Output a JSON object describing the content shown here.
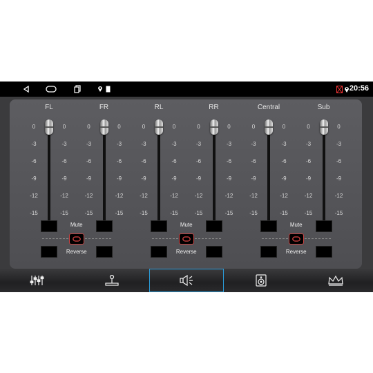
{
  "status": {
    "time": "20:56"
  },
  "channels": [
    {
      "label": "FL",
      "level_db": 0
    },
    {
      "label": "FR",
      "level_db": 0
    },
    {
      "label": "RL",
      "level_db": 0
    },
    {
      "label": "RR",
      "level_db": 0
    },
    {
      "label": "Central",
      "level_db": 0
    },
    {
      "label": "Sub",
      "level_db": 0
    }
  ],
  "scale": [
    "0",
    "-3",
    "-6",
    "-9",
    "-12",
    "-15"
  ],
  "groups": [
    {
      "mute_label": "Mute",
      "reverse_label": "Reverse"
    },
    {
      "mute_label": "Mute",
      "reverse_label": "Reverse"
    },
    {
      "mute_label": "Mute",
      "reverse_label": "Reverse"
    }
  ],
  "tabs": [
    {
      "icon": "equalizer-icon"
    },
    {
      "icon": "balance-joystick-icon"
    },
    {
      "icon": "speaker-icon",
      "active": true
    },
    {
      "icon": "subwoofer-icon"
    },
    {
      "icon": "crown-icon"
    }
  ],
  "colors": {
    "accent": "#2a9bd8",
    "panel": "#58585c",
    "link": "#cc4444"
  }
}
